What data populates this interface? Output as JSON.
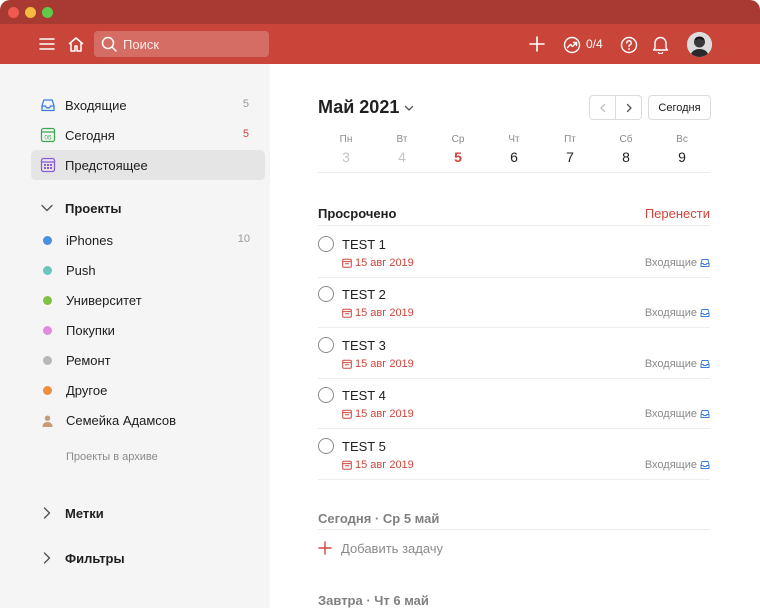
{
  "colors": {
    "accent": "#c9453a",
    "titlebar": "#a93a31",
    "overdue": "#d1453b"
  },
  "topbar": {
    "menu_icon": "hamburger-icon",
    "home_icon": "home-icon",
    "search_placeholder": "Поиск",
    "add_icon": "plus-icon",
    "karma_icon": "productivity-icon",
    "karma_value": "0/4",
    "help_icon": "help-icon",
    "notifications_icon": "bell-icon"
  },
  "sidebar": {
    "nav": [
      {
        "label": "Входящие",
        "count": "5",
        "icon": "inbox-icon"
      },
      {
        "label": "Сегодня",
        "count": "5",
        "icon": "calendar-today-icon"
      },
      {
        "label": "Предстоящее",
        "count": "",
        "icon": "calendar-upcoming-icon"
      }
    ],
    "projects_title": "Проекты",
    "projects": [
      {
        "label": "iPhones",
        "count": "10",
        "color": "#4a90e2"
      },
      {
        "label": "Push",
        "count": "",
        "color": "#6cc6bd"
      },
      {
        "label": "Университет",
        "count": "",
        "color": "#7ec245"
      },
      {
        "label": "Покупки",
        "count": "",
        "color": "#e28ae0"
      },
      {
        "label": "Ремонт",
        "count": "",
        "color": "#b8b8b8"
      },
      {
        "label": "Другое",
        "count": "",
        "color": "#ef8e3c"
      },
      {
        "label": "Семейка Адамсов",
        "count": "",
        "icon": "shared-person-icon",
        "color": "#c99a78"
      }
    ],
    "archived_label": "Проекты в архиве",
    "labels_title": "Метки",
    "filters_title": "Фильтры"
  },
  "main": {
    "month_title": "Май 2021",
    "today_button": "Сегодня",
    "week": [
      {
        "name": "Пн",
        "date": "3",
        "state": "past"
      },
      {
        "name": "Вт",
        "date": "4",
        "state": "past"
      },
      {
        "name": "Ср",
        "date": "5",
        "state": "today"
      },
      {
        "name": "Чт",
        "date": "6",
        "state": "future"
      },
      {
        "name": "Пт",
        "date": "7",
        "state": "future"
      },
      {
        "name": "Сб",
        "date": "8",
        "state": "future"
      },
      {
        "name": "Вс",
        "date": "9",
        "state": "future"
      }
    ],
    "overdue_title": "Просрочено",
    "reschedule_label": "Перенести",
    "tasks": [
      {
        "title": "TEST 1",
        "due": "15 авг 2019",
        "project": "Входящие"
      },
      {
        "title": "TEST 2",
        "due": "15 авг 2019",
        "project": "Входящие"
      },
      {
        "title": "TEST 3",
        "due": "15 авг 2019",
        "project": "Входящие"
      },
      {
        "title": "TEST 4",
        "due": "15 авг 2019",
        "project": "Входящие"
      },
      {
        "title": "TEST 5",
        "due": "15 авг 2019",
        "project": "Входящие"
      }
    ],
    "today_section": "Сегодня · Ср 5 май",
    "add_task_label": "Добавить задачу",
    "tomorrow_section": "Завтра · Чт 6 май"
  }
}
